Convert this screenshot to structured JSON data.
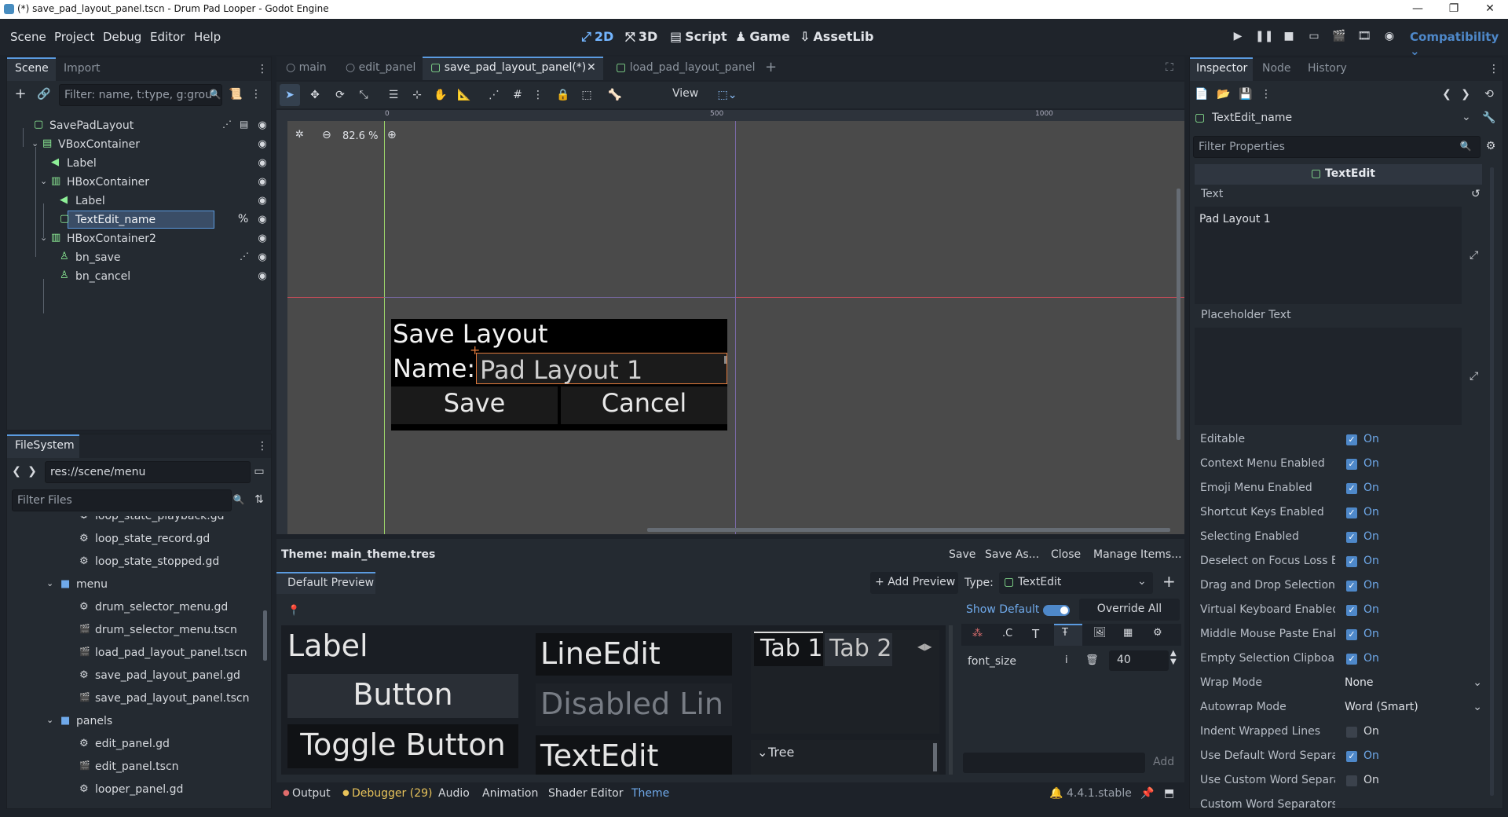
{
  "window": {
    "title": "(*) save_pad_layout_panel.tscn - Drum Pad Looper - Godot Engine",
    "minimize": "—",
    "maximize": "❐",
    "close": "✕"
  },
  "menu": {
    "items": [
      "Scene",
      "Project",
      "Debug",
      "Editor",
      "Help"
    ],
    "workspaces": [
      {
        "label": "2D",
        "icon": "2d-icon",
        "active": true
      },
      {
        "label": "3D",
        "icon": "3d-icon",
        "active": false
      },
      {
        "label": "Script",
        "icon": "script-icon",
        "active": false
      },
      {
        "label": "Game",
        "icon": "game-icon",
        "active": false
      },
      {
        "label": "AssetLib",
        "icon": "assetlib-icon",
        "active": false
      }
    ],
    "renderer": "Compatibility"
  },
  "scene_dock": {
    "tabs": [
      "Scene",
      "Import"
    ],
    "filter_placeholder": "Filter: name, t:type, g:grou",
    "nodes": [
      {
        "name": "SavePadLayout",
        "type": "control",
        "indent": 0
      },
      {
        "name": "VBoxContainer",
        "type": "vbox",
        "indent": 1
      },
      {
        "name": "Label",
        "type": "label",
        "indent": 2
      },
      {
        "name": "HBoxContainer",
        "type": "hbox",
        "indent": 2
      },
      {
        "name": "Label",
        "type": "label",
        "indent": 3
      },
      {
        "name": "TextEdit_name",
        "type": "textedit",
        "indent": 3,
        "selected": true,
        "badge": "%"
      },
      {
        "name": "HBoxContainer2",
        "type": "hbox",
        "indent": 2
      },
      {
        "name": "bn_save",
        "type": "button",
        "indent": 3
      },
      {
        "name": "bn_cancel",
        "type": "button",
        "indent": 3
      }
    ]
  },
  "filesystem": {
    "tab": "FileSystem",
    "path": "res://scene/menu",
    "filter_placeholder": "Filter Files",
    "items": [
      {
        "name": "loop_state_playback.gd",
        "kind": "gd",
        "indent": 2
      },
      {
        "name": "loop_state_record.gd",
        "kind": "gd",
        "indent": 2
      },
      {
        "name": "loop_state_stopped.gd",
        "kind": "gd",
        "indent": 2
      },
      {
        "name": "menu",
        "kind": "folder",
        "indent": 1
      },
      {
        "name": "drum_selector_menu.gd",
        "kind": "gd",
        "indent": 2
      },
      {
        "name": "drum_selector_menu.tscn",
        "kind": "tscn",
        "indent": 2
      },
      {
        "name": "load_pad_layout_panel.tscn",
        "kind": "tscn",
        "indent": 2
      },
      {
        "name": "save_pad_layout_panel.gd",
        "kind": "gd",
        "indent": 2
      },
      {
        "name": "save_pad_layout_panel.tscn",
        "kind": "tscn",
        "indent": 2
      },
      {
        "name": "panels",
        "kind": "folder",
        "indent": 1
      },
      {
        "name": "edit_panel.gd",
        "kind": "gd",
        "indent": 2
      },
      {
        "name": "edit_panel.tscn",
        "kind": "tscn",
        "indent": 2
      },
      {
        "name": "looper_panel.gd",
        "kind": "gd",
        "indent": 2
      }
    ]
  },
  "editor_tabs": [
    {
      "label": "main",
      "active": false,
      "kind": "circle"
    },
    {
      "label": "edit_panel",
      "active": false,
      "kind": "circle"
    },
    {
      "label": "save_pad_layout_panel(*)",
      "active": true,
      "kind": "control"
    },
    {
      "label": "load_pad_layout_panel",
      "active": false,
      "kind": "control"
    }
  ],
  "toolbar": {
    "view_label": "View"
  },
  "viewport": {
    "zoom": "82.6 %",
    "ruler_marks": [
      "0",
      "500",
      "1000"
    ],
    "preview": {
      "title": "Save Layout",
      "name_label": "Name:",
      "name_value": "Pad Layout 1",
      "save": "Save",
      "cancel": "Cancel"
    }
  },
  "theme_editor": {
    "title": "Theme: main_theme.tres",
    "actions": [
      "Save",
      "Save As...",
      "Close",
      "Manage Items..."
    ],
    "preview_tab": "Default Preview",
    "add_preview": "Add Preview",
    "type_label": "Type:",
    "type_value": "TextEdit",
    "show_default": "Show Default",
    "override_all": "Override All",
    "font_size_label": "font_size",
    "font_size_value": "40",
    "add_label": "Add",
    "preview": {
      "label": "Label",
      "button": "Button",
      "toggle_button": "Toggle Button",
      "line_edit": "LineEdit",
      "disabled_line": "Disabled Lin",
      "text_edit": "TextEdit",
      "tab1": "Tab 1",
      "tab2": "Tab 2",
      "tree": "Tree"
    }
  },
  "bottom_panel": {
    "tabs": [
      "Output",
      "Debugger (29)",
      "Audio",
      "Animation",
      "Shader Editor",
      "Theme"
    ],
    "version": "4.4.1.stable"
  },
  "inspector": {
    "tabs": [
      "Inspector",
      "Node",
      "History"
    ],
    "node_name": "TextEdit_name",
    "filter_placeholder": "Filter Properties",
    "class_header": "TextEdit",
    "text_label": "Text",
    "text_value": "Pad Layout 1",
    "placeholder_label": "Placeholder Text",
    "properties": [
      {
        "name": "Editable",
        "type": "bool",
        "value": "On",
        "checked": true
      },
      {
        "name": "Context Menu Enabled",
        "type": "bool",
        "value": "On",
        "checked": true
      },
      {
        "name": "Emoji Menu Enabled",
        "type": "bool",
        "value": "On",
        "checked": true
      },
      {
        "name": "Shortcut Keys Enabled",
        "type": "bool",
        "value": "On",
        "checked": true
      },
      {
        "name": "Selecting Enabled",
        "type": "bool",
        "value": "On",
        "checked": true
      },
      {
        "name": "Deselect on Focus Loss En",
        "type": "bool",
        "value": "On",
        "checked": true
      },
      {
        "name": "Drag and Drop Selection E",
        "type": "bool",
        "value": "On",
        "checked": true
      },
      {
        "name": "Virtual Keyboard Enabled",
        "type": "bool",
        "value": "On",
        "checked": true
      },
      {
        "name": "Middle Mouse Paste Enabl",
        "type": "bool",
        "value": "On",
        "checked": true
      },
      {
        "name": "Empty Selection Clipboard",
        "type": "bool",
        "value": "On",
        "checked": true
      },
      {
        "name": "Wrap Mode",
        "type": "enum",
        "value": "None"
      },
      {
        "name": "Autowrap Mode",
        "type": "enum",
        "value": "Word (Smart)"
      },
      {
        "name": "Indent Wrapped Lines",
        "type": "bool",
        "value": "On",
        "checked": false
      },
      {
        "name": "Use Default Word Separat",
        "type": "bool",
        "value": "On",
        "checked": true
      },
      {
        "name": "Use Custom Word Separat",
        "type": "bool",
        "value": "On",
        "checked": false
      },
      {
        "name": "Custom Word Separators",
        "type": "text",
        "value": ""
      }
    ]
  },
  "colors": {
    "accent": "#5b9be0",
    "control_green": "#8eef97",
    "selection": "#3a4d66"
  }
}
